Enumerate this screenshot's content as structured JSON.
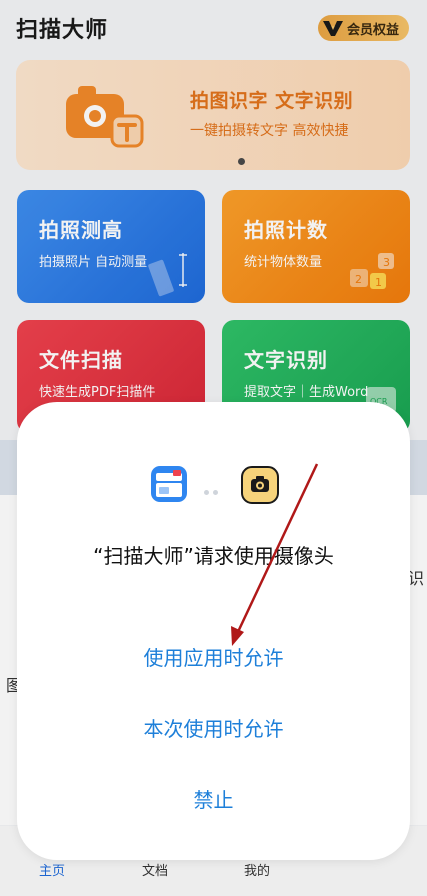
{
  "header": {
    "app_title": "扫描大师",
    "vip_label": "会员权益"
  },
  "banner": {
    "title": "拍图识字 文字识别",
    "subtitle": "一键拍摄转文字 高效快捷"
  },
  "cards": [
    {
      "title": "拍照测高",
      "subtitle": "拍摄照片 自动测量",
      "color": "#2a7be6"
    },
    {
      "title": "拍照计数",
      "subtitle": "统计物体数量",
      "color": "#f68a18"
    },
    {
      "title": "文件扫描",
      "subtitle": "快速生成PDF扫描件",
      "color": "#e3333f"
    },
    {
      "title": "文字识别",
      "subtitle": "提取文字｜生成Word",
      "color": "#24b45e"
    }
  ],
  "background_peek": {
    "left_char": "图",
    "right_char": "识"
  },
  "tabbar": {
    "items": [
      {
        "label": "主页"
      },
      {
        "label": "文档"
      },
      {
        "label": "我的"
      }
    ]
  },
  "permission_dialog": {
    "message": "“扫描大师”请求使用摄像头",
    "allow_while_using": "使用应用时允许",
    "allow_once": "本次使用时允许",
    "deny": "禁止",
    "accent_color": "#1d7fd9"
  },
  "annotation": {
    "arrow_color": "#b01818"
  }
}
